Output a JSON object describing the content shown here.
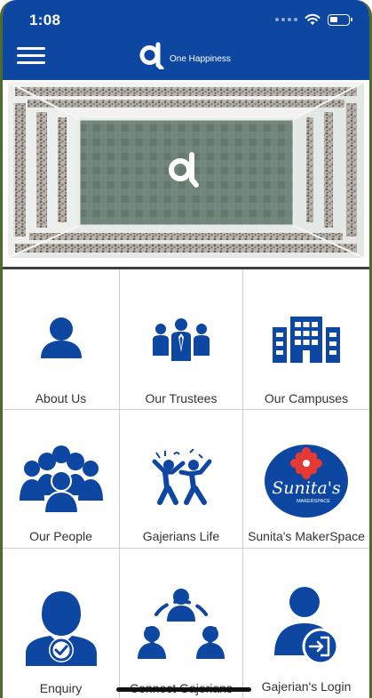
{
  "status_bar": {
    "time": "1:08"
  },
  "header": {
    "brand_name": "One Happiness",
    "menu_icon": "hamburger-menu-icon",
    "logo_icon": "alpha-logo-icon"
  },
  "hero": {
    "logo_icon": "alpha-logo-icon"
  },
  "colors": {
    "brand_blue": "#0d47a1",
    "icon_blue": "#0d47a1",
    "makerspace_red": "#e53935"
  },
  "tiles": [
    {
      "label": "About Us",
      "icon": "person-icon"
    },
    {
      "label": "Our Trustees",
      "icon": "trustees-group-icon"
    },
    {
      "label": "Our Campuses",
      "icon": "buildings-icon"
    },
    {
      "label": "Our People",
      "icon": "people-group-icon"
    },
    {
      "label": "Gajerians Life",
      "icon": "celebration-icon"
    },
    {
      "label": "Sunita's MakerSpace",
      "icon": "makerspace-logo-icon",
      "logo_text": "Sunita's",
      "logo_subtext": "MAKERSPACE"
    },
    {
      "label": "Enquiry",
      "icon": "enquiry-person-check-icon"
    },
    {
      "label": "Connect Gajerians",
      "icon": "connect-people-icon"
    },
    {
      "label": "Gajerian's Login",
      "icon": "login-person-icon"
    }
  ]
}
